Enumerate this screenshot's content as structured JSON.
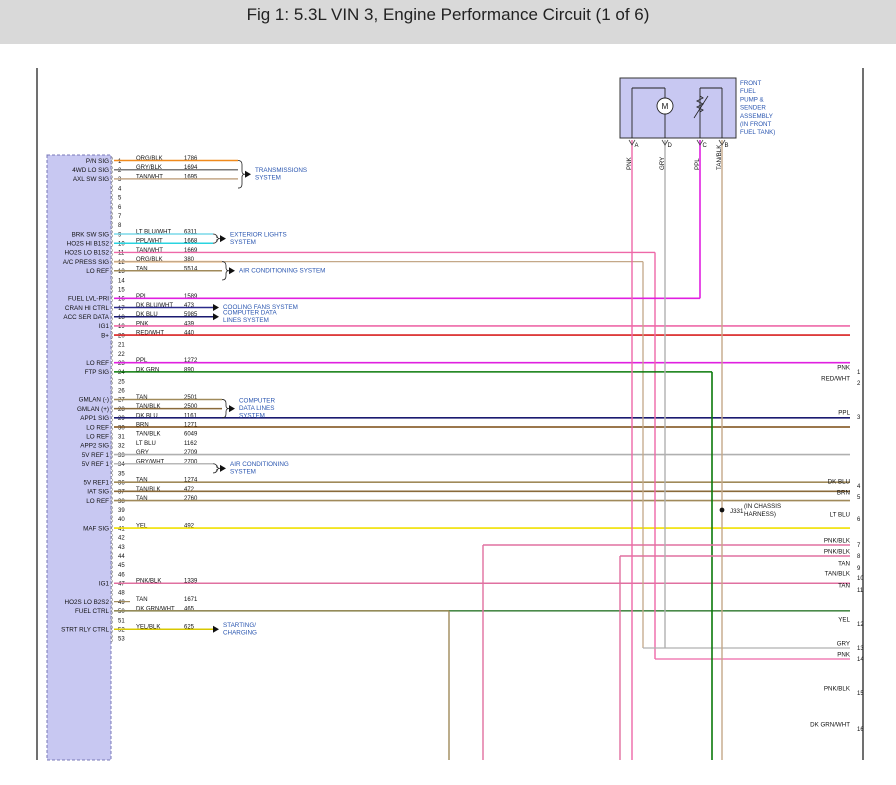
{
  "title": "Fig 1: 5.3L VIN 3, Engine Performance Circuit (1 of 6)",
  "colors": {
    "ORG/BLK": "#f08a1c",
    "GRY/BLK": "#7a7a7a",
    "TAN/WHT": "#c4a888",
    "LT BLU/WHT": "#7ad8e8",
    "PPL/WHT": "#2ad4e0",
    "TAN": "#a08a5a",
    "PPL": "#e020e0",
    "DK BLU/WHT": "#2a2a8a",
    "DK BLU": "#1a1a70",
    "PNK": "#ee68a8",
    "RED/WHT": "#d82020",
    "DK GRN": "#0a7a0a",
    "TAN/BLK": "#8a6a3a",
    "BRN": "#7a4a10",
    "LT BLU": "#30d0d0",
    "GRY": "#b0b0b0",
    "GRY/WHT": "#b8b8b8",
    "YEL": "#f0e000",
    "PNK/BLK": "#e070a0",
    "DK GRN/WHT": "#4a8a4a",
    "YEL/BLK": "#d8c800"
  },
  "module_pins": [
    {
      "pin": "1",
      "label": "P/N SIG",
      "wire": "ORG/BLK",
      "circuit": "1786"
    },
    {
      "pin": "2",
      "label": "4WD LO SIG",
      "wire": "GRY/BLK",
      "circuit": "1694"
    },
    {
      "pin": "3",
      "label": "AXL SW SIG",
      "wire": "TAN/WHT",
      "circuit": "1695"
    },
    {
      "pin": "4",
      "label": "",
      "wire": "",
      "circuit": ""
    },
    {
      "pin": "5",
      "label": "",
      "wire": "",
      "circuit": ""
    },
    {
      "pin": "6",
      "label": "",
      "wire": "",
      "circuit": ""
    },
    {
      "pin": "7",
      "label": "",
      "wire": "",
      "circuit": ""
    },
    {
      "pin": "8",
      "label": "",
      "wire": "",
      "circuit": ""
    },
    {
      "pin": "9",
      "label": "BRK SW SIG",
      "wire": "LT BLU/WHT",
      "circuit": "6311"
    },
    {
      "pin": "10",
      "label": "HO2S HI B1S2",
      "wire": "PPL/WHT",
      "circuit": "1668"
    },
    {
      "pin": "11",
      "label": "HO2S LO B1S2",
      "wire": "TAN/WHT",
      "circuit": "1669"
    },
    {
      "pin": "12",
      "label": "A/C PRESS SIG",
      "wire": "ORG/BLK",
      "circuit": "380"
    },
    {
      "pin": "13",
      "label": "LO REF",
      "wire": "TAN",
      "circuit": "5514"
    },
    {
      "pin": "14",
      "label": "",
      "wire": "",
      "circuit": ""
    },
    {
      "pin": "15",
      "label": "",
      "wire": "",
      "circuit": ""
    },
    {
      "pin": "16",
      "label": "FUEL LVL-PRI",
      "wire": "PPL",
      "circuit": "1589"
    },
    {
      "pin": "17",
      "label": "CRAN HI CTRL",
      "wire": "DK BLU/WHT",
      "circuit": "473"
    },
    {
      "pin": "18",
      "label": "ACC SER DATA",
      "wire": "DK BLU",
      "circuit": "5985"
    },
    {
      "pin": "19",
      "label": "IG1",
      "wire": "PNK",
      "circuit": "439"
    },
    {
      "pin": "20",
      "label": "B+",
      "wire": "RED/WHT",
      "circuit": "440"
    },
    {
      "pin": "21",
      "label": "",
      "wire": "",
      "circuit": ""
    },
    {
      "pin": "22",
      "label": "",
      "wire": "",
      "circuit": ""
    },
    {
      "pin": "23",
      "label": "LO REF",
      "wire": "PPL",
      "circuit": "1272"
    },
    {
      "pin": "24",
      "label": "FTP SIG",
      "wire": "DK GRN",
      "circuit": "890"
    },
    {
      "pin": "25",
      "label": "",
      "wire": "",
      "circuit": ""
    },
    {
      "pin": "26",
      "label": "",
      "wire": "",
      "circuit": ""
    },
    {
      "pin": "27",
      "label": "GMLAN (-)",
      "wire": "TAN",
      "circuit": "2501"
    },
    {
      "pin": "28",
      "label": "GMLAN (+)",
      "wire": "TAN/BLK",
      "circuit": "2500"
    },
    {
      "pin": "29",
      "label": "APP1 SIG",
      "wire": "DK BLU",
      "circuit": "1161"
    },
    {
      "pin": "30",
      "label": "LO REF",
      "wire": "BRN",
      "circuit": "1271"
    },
    {
      "pin": "31",
      "label": "LO REF",
      "wire": "TAN/BLK",
      "circuit": "6049"
    },
    {
      "pin": "32",
      "label": "APP2 SIG",
      "wire": "LT BLU",
      "circuit": "1162"
    },
    {
      "pin": "33",
      "label": "5V REF 1",
      "wire": "GRY",
      "circuit": "2709"
    },
    {
      "pin": "34",
      "label": "5V REF 1",
      "wire": "GRY/WHT",
      "circuit": "2700"
    },
    {
      "pin": "35",
      "label": "",
      "wire": "",
      "circuit": ""
    },
    {
      "pin": "36",
      "label": "5V REF1",
      "wire": "TAN",
      "circuit": "1274"
    },
    {
      "pin": "37",
      "label": "IAT SIG",
      "wire": "TAN/BLK",
      "circuit": "472"
    },
    {
      "pin": "38",
      "label": "LO REF",
      "wire": "TAN",
      "circuit": "2760"
    },
    {
      "pin": "39",
      "label": "",
      "wire": "",
      "circuit": ""
    },
    {
      "pin": "40",
      "label": "",
      "wire": "",
      "circuit": ""
    },
    {
      "pin": "41",
      "label": "MAF SIG",
      "wire": "YEL",
      "circuit": "492"
    },
    {
      "pin": "42",
      "label": "",
      "wire": "",
      "circuit": ""
    },
    {
      "pin": "43",
      "label": "",
      "wire": "",
      "circuit": ""
    },
    {
      "pin": "44",
      "label": "",
      "wire": "",
      "circuit": ""
    },
    {
      "pin": "45",
      "label": "",
      "wire": "",
      "circuit": ""
    },
    {
      "pin": "46",
      "label": "",
      "wire": "",
      "circuit": ""
    },
    {
      "pin": "47",
      "label": "IG1",
      "wire": "PNK/BLK",
      "circuit": "1339"
    },
    {
      "pin": "48",
      "label": "",
      "wire": "",
      "circuit": ""
    },
    {
      "pin": "49",
      "label": "HO2S LO B2S2",
      "wire": "TAN",
      "circuit": "1671"
    },
    {
      "pin": "50",
      "label": "FUEL CTRL",
      "wire": "DK GRN/WHT",
      "circuit": "465"
    },
    {
      "pin": "51",
      "label": "",
      "wire": "",
      "circuit": ""
    },
    {
      "pin": "52",
      "label": "STRT RLY CTRL",
      "wire": "YEL/BLK",
      "circuit": "625"
    },
    {
      "pin": "53",
      "label": "",
      "wire": "",
      "circuit": ""
    }
  ],
  "references": [
    {
      "first_pin": "1",
      "last_pin": "4",
      "lines": [
        "TRANSMISSIONS",
        "SYSTEM"
      ]
    },
    {
      "first_pin": "9",
      "last_pin": "10",
      "lines": [
        "EXTERIOR LIGHTS",
        "SYSTEM"
      ]
    },
    {
      "first_pin": "12",
      "last_pin": "14",
      "lines": [
        "AIR CONDITIONING SYSTEM"
      ]
    },
    {
      "first_pin": "17",
      "last_pin": "17",
      "lines": [
        "COOLING FANS SYSTEM"
      ]
    },
    {
      "first_pin": "18",
      "last_pin": "18",
      "lines": [
        "COMPUTER DATA",
        "LINES SYSTEM"
      ]
    },
    {
      "first_pin": "27",
      "last_pin": "29",
      "lines": [
        "COMPUTER",
        "DATA LINES",
        "SYSTEM"
      ]
    },
    {
      "first_pin": "34",
      "last_pin": "35",
      "lines": [
        "AIR CONDITIONING",
        "SYSTEM"
      ]
    },
    {
      "first_pin": "52",
      "last_pin": "52",
      "lines": [
        "STARTING/",
        "CHARGING"
      ]
    }
  ],
  "pump_assembly": {
    "lines": [
      "FRONT",
      "FUEL",
      "PUMP &",
      "SENDER",
      "ASSEMBLY",
      "(IN FRONT",
      "FUEL TANK)"
    ],
    "motor_symbol": "M",
    "motor_icon": "motor-icon",
    "sender_icon": "variable-resistor-icon",
    "terminals": [
      {
        "label": "PNK",
        "pin": "A"
      },
      {
        "label": "GRY",
        "pin": "D"
      },
      {
        "label": "PPL",
        "pin": "C"
      },
      {
        "label": "TAN/BLK",
        "pin": "B"
      }
    ]
  },
  "splice": {
    "name": "J331",
    "lines": [
      "(IN CHASSIS",
      "HARNESS)"
    ]
  },
  "right_connectors": [
    {
      "num": "1",
      "wire": "PNK"
    },
    {
      "num": "2",
      "wire": "RED/WHT"
    },
    {
      "num": "3",
      "wire": "PPL"
    },
    {
      "num": "4",
      "wire": "DK BLU"
    },
    {
      "num": "5",
      "wire": "BRN"
    },
    {
      "num": "6",
      "wire": "LT BLU"
    },
    {
      "num": "7",
      "wire": "PNK/BLK"
    },
    {
      "num": "8",
      "wire": "PNK/BLK"
    },
    {
      "num": "9",
      "wire": "TAN"
    },
    {
      "num": "10",
      "wire": "TAN/BLK"
    },
    {
      "num": "11",
      "wire": "TAN"
    },
    {
      "num": "12",
      "wire": "YEL"
    },
    {
      "num": "13",
      "wire": "GRY"
    },
    {
      "num": "14",
      "wire": "PNK"
    },
    {
      "num": "15",
      "wire": "PNK/BLK"
    },
    {
      "num": "16",
      "wire": "DK GRN/WHT"
    }
  ]
}
